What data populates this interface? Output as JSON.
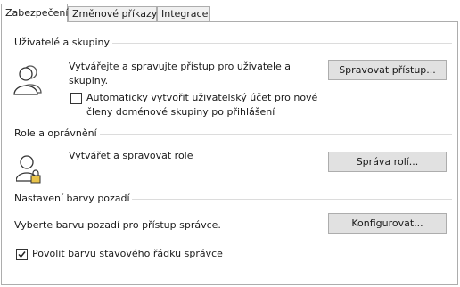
{
  "tabs": [
    {
      "label": "Zabezpečení",
      "active": true
    },
    {
      "label": "Změnové příkazy",
      "active": false
    },
    {
      "label": "Integrace",
      "active": false
    }
  ],
  "users_groups": {
    "title": "Uživatelé a skupiny",
    "description": "Vytvářejte a spravujte přístup pro uživatele a skupiny.",
    "button": "Spravovat přístup...",
    "auto_create_label": "Automaticky vytvořit uživatelský účet pro nové členy doménové skupiny po přihlášení",
    "auto_create_checked": false,
    "icon": "user-silhouette-icon"
  },
  "roles": {
    "title": "Role a oprávnění",
    "description": "Vytvářet a spravovat role",
    "button": "Správa rolí...",
    "icon": "user-lock-icon"
  },
  "background": {
    "title": "Nastavení barvy pozadí",
    "description": "Vyberte barvu pozadí pro přístup správce.",
    "button": "Konfigurovat...",
    "statusbar_label": "Povolit barvu stavového řádku správce",
    "statusbar_checked": true
  }
}
